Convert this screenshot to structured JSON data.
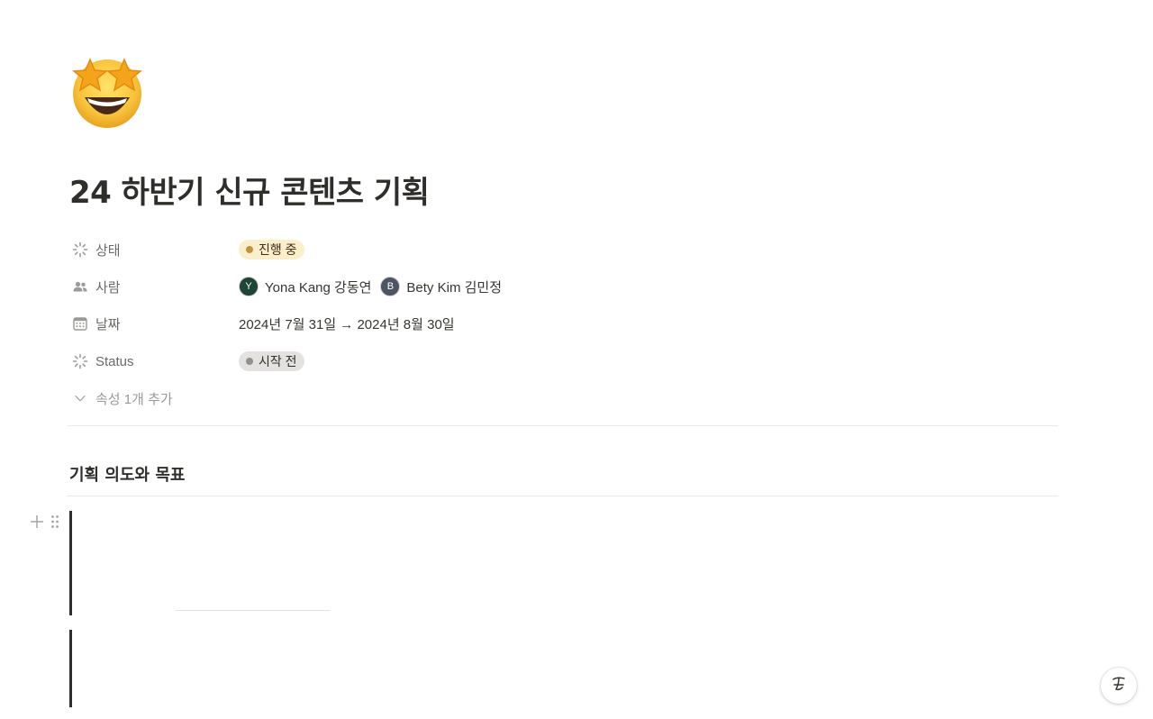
{
  "page": {
    "icon": "star-struck-emoji-icon",
    "title": "24 하반기 신규 콘텐츠 기획"
  },
  "properties": [
    {
      "name": "상태",
      "icon": "status-spinner-icon",
      "type": "status",
      "value": "진행 중",
      "color": "#c29243"
    },
    {
      "name": "사람",
      "icon": "people-icon",
      "type": "people",
      "people": [
        {
          "initial": "Y",
          "name": "Yona Kang 강동연",
          "color": "#1e4536"
        },
        {
          "initial": "B",
          "name": "Bety Kim 김민정",
          "color": "#4c5563"
        }
      ]
    },
    {
      "name": "날짜",
      "icon": "calendar-icon",
      "type": "date",
      "value": "2024년 7월 31일 → 2024년 8월 30일"
    },
    {
      "name": "Status",
      "icon": "status-spinner-icon",
      "type": "status",
      "value": "시작 전",
      "color": "#91918e"
    }
  ],
  "add_property": {
    "label": "속성 1개 추가",
    "icon": "chevron-down-icon"
  },
  "content": {
    "heading": "기획 의도와 목표"
  },
  "block_controls": {
    "add_icon": "plus-icon",
    "drag_icon": "drag-handle-icon"
  },
  "help_button": {
    "icon": "notion-help-icon"
  },
  "colors": {
    "text": "#37352f",
    "muted": "#9b9a97",
    "in_progress_bg": "#fbeecb",
    "not_started_bg": "#e3e2e0"
  }
}
